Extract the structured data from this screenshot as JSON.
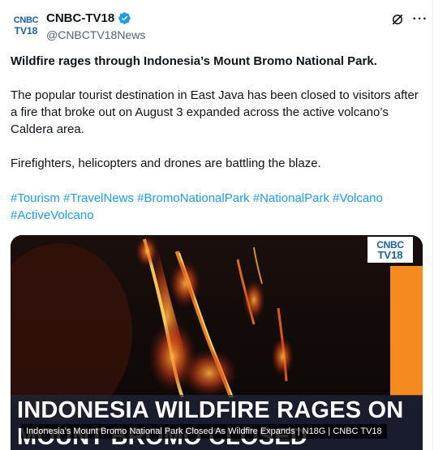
{
  "author": {
    "avatar_line1": "CNBC",
    "avatar_line2": "TV18",
    "name": "CNBC-TV18",
    "handle": "@CNBCTV18News",
    "verified_icon": "verified-badge-icon"
  },
  "header_actions": {
    "grok_icon": "grok-icon",
    "more_label": "···"
  },
  "tweet": {
    "headline": "Wildfire rages through Indonesia’s Mount Bromo National Park.",
    "paragraph": "The popular tourist destination in East Java has been closed to visitors after a fire that broke out on August 3 expanded across the active volcano’s Caldera area.",
    "paragraph2": "Firefighters, helicopters and drones are battling the blaze.",
    "hashtags": [
      "#Tourism",
      "#TravelNews",
      "#BromoNationalPark",
      "#NationalPark",
      "#Volcano",
      "#ActiveVolcano"
    ]
  },
  "media": {
    "logo_line1": "CNBC",
    "logo_line2": "TV18",
    "banner_line1": "INDONESIA WILDFIRE RAGES ON",
    "banner_line2": "MOUNT BROMO CLOSED",
    "caption": "Indonesia's Mount Bromo National Park Closed As Wildfire Expands | N18G | CNBC TV18",
    "accent_color": "#f58a1f"
  }
}
